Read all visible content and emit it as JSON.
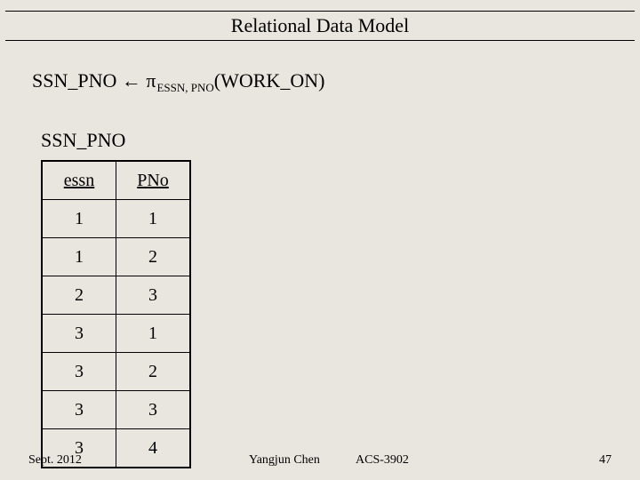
{
  "title": "Relational Data Model",
  "expression": {
    "lhs": "SSN_PNO",
    "arrow": "←",
    "pi": "π",
    "subscript": "ESSN, PNO",
    "arg": "(WORK_ON)"
  },
  "relation_name": "SSN_PNO",
  "table": {
    "headers": [
      "essn",
      "PNo"
    ],
    "rows": [
      [
        "1",
        "1"
      ],
      [
        "1",
        "2"
      ],
      [
        "2",
        "3"
      ],
      [
        "3",
        "1"
      ],
      [
        "3",
        "2"
      ],
      [
        "3",
        "3"
      ],
      [
        "3",
        "4"
      ]
    ]
  },
  "footer": {
    "date": "Sept. 2012",
    "author": "Yangjun Chen",
    "course": "ACS-3902",
    "page": "47"
  }
}
